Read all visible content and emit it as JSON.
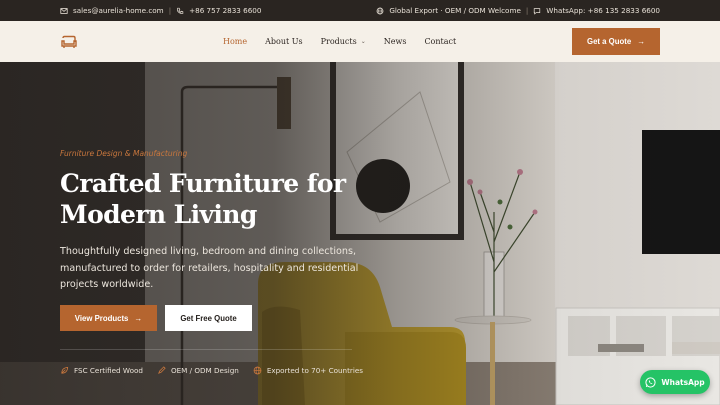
{
  "topbar": {
    "email": "sales@aurelia-home.com",
    "phone": "+86 757 2833 6600",
    "welcome": "Global Export · OEM / ODM Welcome",
    "whatsapp": "WhatsApp: +86 135 2833 6600"
  },
  "nav": {
    "items": [
      {
        "label": "Home",
        "active": true
      },
      {
        "label": "About Us"
      },
      {
        "label": "Products",
        "dropdown": true
      },
      {
        "label": "News"
      },
      {
        "label": "Contact"
      }
    ],
    "cta_label": "Get a Quote"
  },
  "hero": {
    "eyebrow": "Furniture Design & Manufacturing",
    "title_line1": "Crafted Furniture for",
    "title_line2": "Modern Living",
    "lead": "Thoughtfully designed living, bedroom and dining collections, manufactured to order for retailers, hospitality and residential projects worldwide.",
    "primary_button": "View Products",
    "secondary_button": "Get Free Quote",
    "features": [
      "FSC Certified Wood",
      "OEM / ODM Design",
      "Exported to 70+ Countries"
    ]
  },
  "whatsapp_button": "WhatsApp",
  "colors": {
    "accent": "#b5652f",
    "topbar": "#2a2521",
    "header": "#f5f0e8",
    "whatsapp": "#25c366"
  }
}
